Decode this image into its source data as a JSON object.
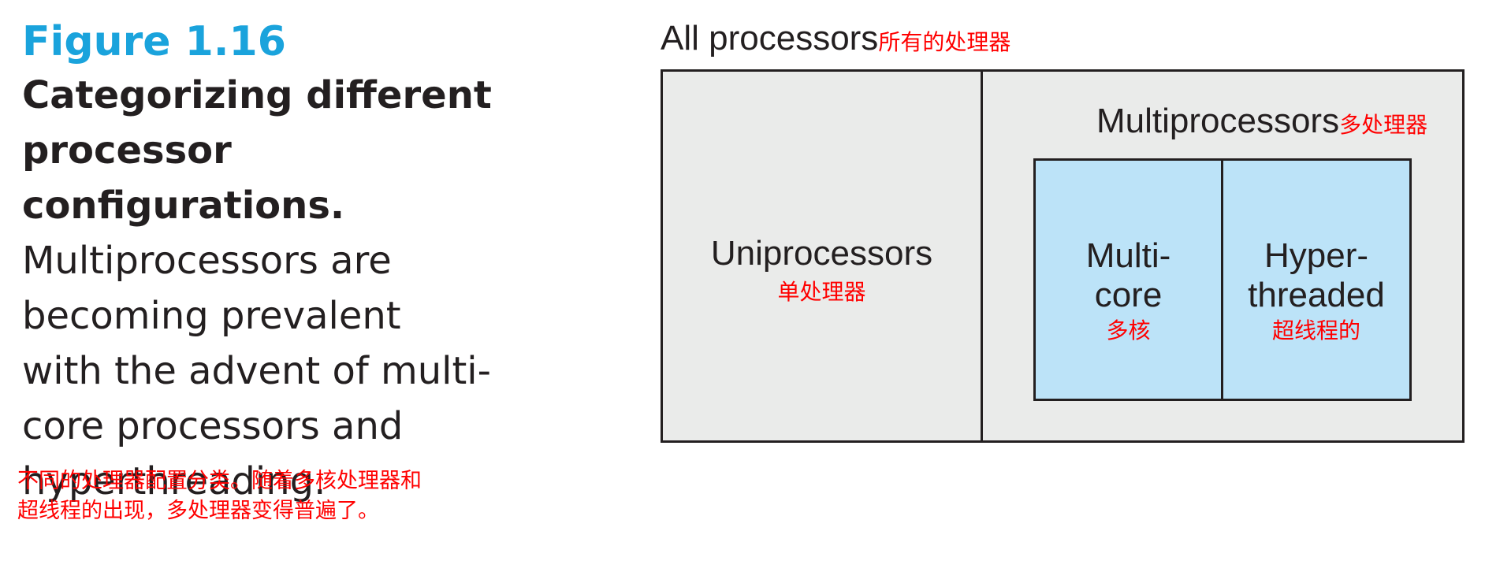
{
  "caption": {
    "figure_number": "Figure 1.16",
    "title_lines": [
      "Categorizing different",
      "processor configurations."
    ],
    "body_lines": [
      "Multiprocessors are",
      "becoming prevalent",
      "with the advent of multi-",
      "core processors and",
      "hyperthreading."
    ],
    "translation_lines": [
      "不同的处理器配置分类。随着多核处理器和",
      "超线程的出现，多处理器变得普遍了。"
    ]
  },
  "diagram": {
    "outer": {
      "label": "All processors",
      "label_zh": "所有的处理器"
    },
    "uniprocessors": {
      "label": "Uniprocessors",
      "label_zh": "单处理器"
    },
    "multiprocessors": {
      "label": "Multiprocessors",
      "label_zh": "多处理器"
    },
    "multicore": {
      "label_lines": [
        "Multi-",
        "core"
      ],
      "label_zh": "多核"
    },
    "hyperthreaded": {
      "label_lines": [
        "Hyper-",
        "threaded"
      ],
      "label_zh": "超线程的"
    }
  },
  "colors": {
    "figure_number": "#1aa3dc",
    "text": "#231f20",
    "translation": "#ff0000",
    "outer_fill": "#eaebea",
    "inner_fill": "#bce3f8"
  }
}
